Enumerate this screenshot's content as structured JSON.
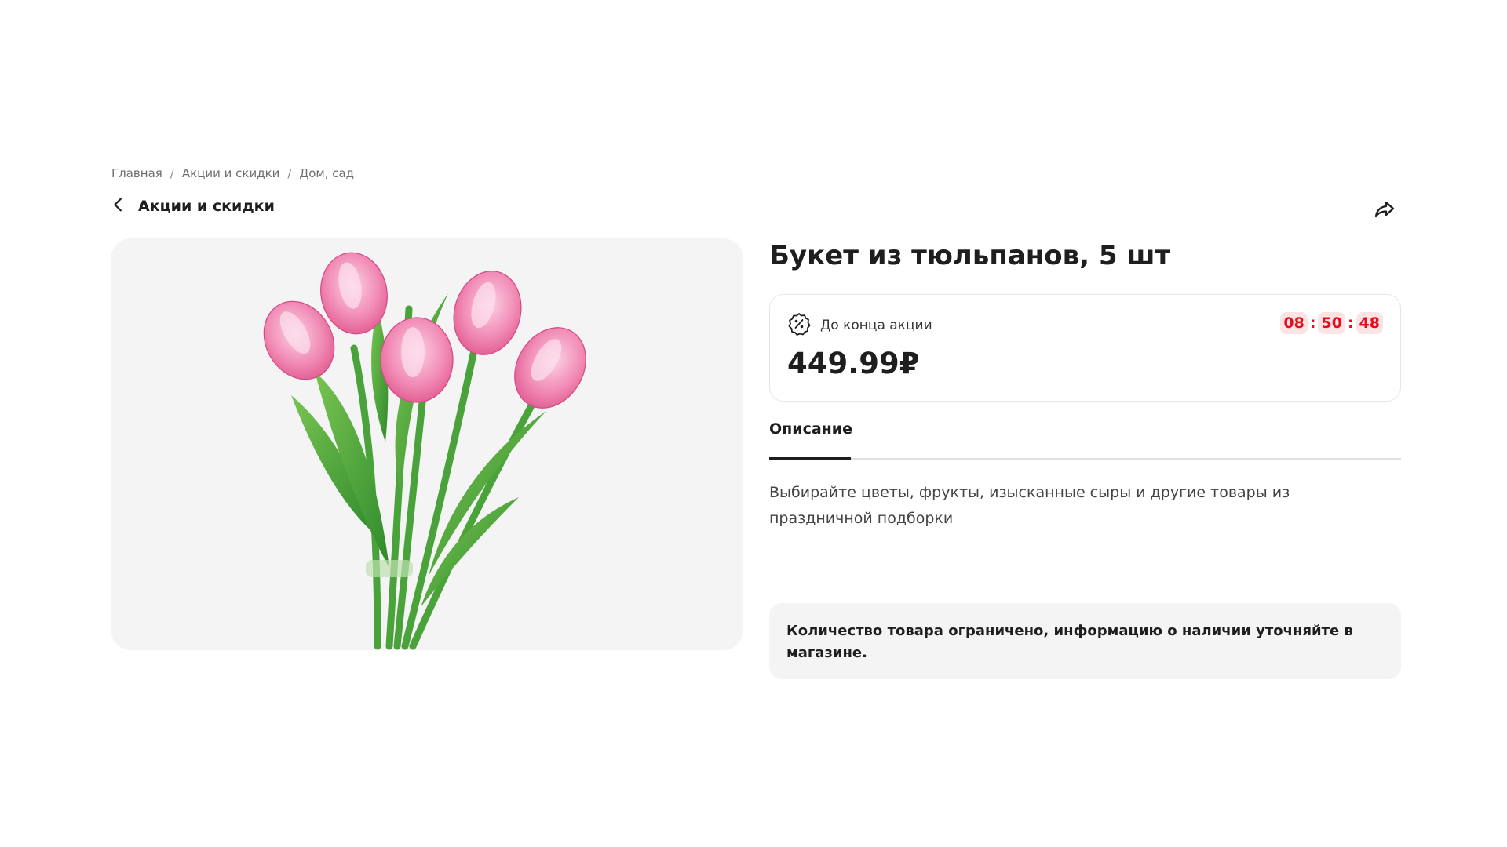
{
  "breadcrumb": {
    "items": [
      "Главная",
      "Акции и скидки",
      "Дом, сад"
    ],
    "separator": "/"
  },
  "back_link": {
    "label": "Акции и скидки",
    "icon": "chevron-left-icon"
  },
  "share": {
    "icon": "share-icon"
  },
  "product": {
    "title": "Букет из тюльпанов, 5 шт",
    "image_icon": "tulip-bouquet-image"
  },
  "promo": {
    "label": "До конца акции",
    "icon": "discount-badge-icon",
    "timer": {
      "hours": "08",
      "minutes": "50",
      "seconds": "48",
      "separator": ":"
    },
    "price": "449.99₽"
  },
  "tabs": [
    {
      "label": "Описание",
      "active": true
    }
  ],
  "description": "Выбирайте цветы, фрукты, изысканные сыры и другие товары из праздничной подборки",
  "notice": "Количество товара ограничено, информацию о наличии уточняйте в магазине.",
  "colors": {
    "timer_text": "#e30f1d",
    "timer_bg": "#fde4e4",
    "card_bg": "#f4f4f4",
    "text_primary": "#1e1e1e"
  }
}
